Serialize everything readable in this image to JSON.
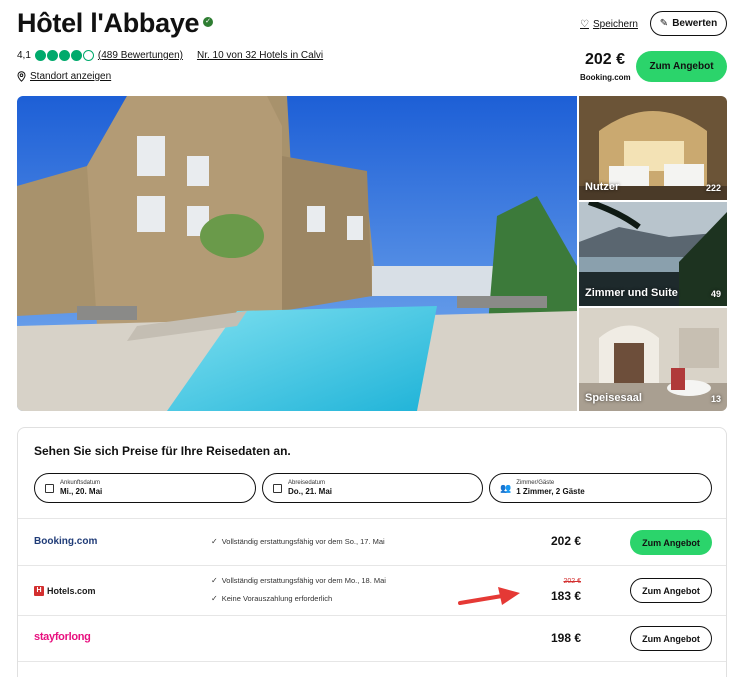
{
  "hotel": {
    "name": "Hôtel l'Abbaye",
    "rating": "4,1",
    "rating_value": 4.1,
    "rating_max": 5,
    "reviews": "(489 Bewertungen)",
    "rank": "Nr. 10 von 32 Hotels in Calvi",
    "location_link": "Standort anzeigen"
  },
  "actions": {
    "save": "Speichern",
    "review": "Bewerten"
  },
  "best_offer": {
    "price": "202 €",
    "provider": "Booking.com",
    "button": "Zum Angebot"
  },
  "gallery": {
    "thumbs": [
      {
        "label": "Nutzer",
        "count": "222"
      },
      {
        "label": "Zimmer und Suite",
        "count": "49"
      },
      {
        "label": "Speisesaal",
        "count": "13"
      }
    ]
  },
  "pricing": {
    "heading": "Sehen Sie sich Preise für Ihre Reisedaten an.",
    "checkin": {
      "label": "Ankunftsdatum",
      "value": "Mi., 20. Mai"
    },
    "checkout": {
      "label": "Abreisedatum",
      "value": "Do., 21. Mai"
    },
    "guests": {
      "label": "Zimmer/Gäste",
      "value": "1 Zimmer, 2 Gäste"
    },
    "offers": [
      {
        "provider": "Booking.com",
        "features": [
          "Vollständig erstattungsfähig vor dem So., 17. Mai"
        ],
        "price": "202 €",
        "old_price": "",
        "button": "Zum Angebot"
      },
      {
        "provider": "Hotels.com",
        "features": [
          "Vollständig erstattungsfähig vor dem Mo., 18. Mai",
          "Keine Vorauszahlung erforderlich"
        ],
        "price": "183 €",
        "old_price": "202 €",
        "button": "Zum Angebot"
      },
      {
        "provider": "stayforlong",
        "features": [],
        "price": "198 €",
        "old_price": "",
        "button": "Zum Angebot"
      }
    ]
  },
  "colors": {
    "accent_green": "#2bd46b",
    "rating_green": "#00aa6c",
    "strike_red": "#d32f2f",
    "booking_blue": "#1f3b77",
    "stayforlong_pink": "#e8107f"
  }
}
